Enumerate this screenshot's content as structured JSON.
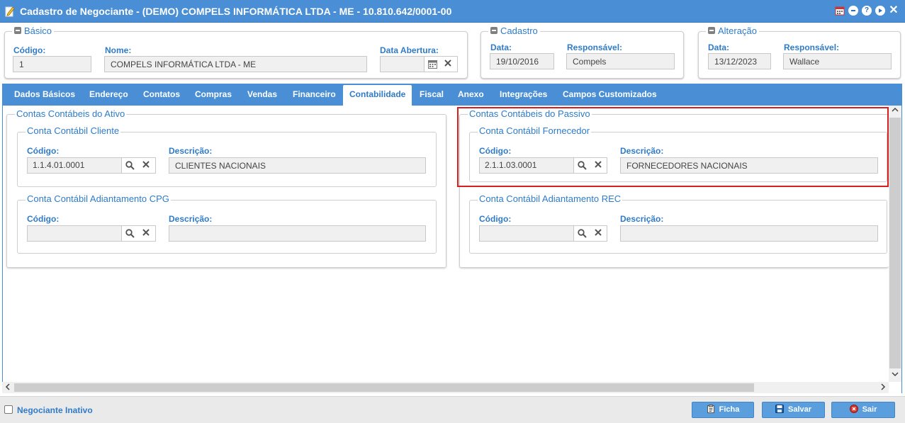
{
  "window": {
    "title": "Cadastro de Negociante - (DEMO) COMPELS INFORMÁTICA LTDA - ME - 10.810.642/0001-00",
    "controls": [
      "calendar-icon",
      "minimize-icon",
      "help-icon",
      "play-icon",
      "close-icon"
    ]
  },
  "basico": {
    "title": "Básico",
    "codigo_label": "Código:",
    "codigo_value": "1",
    "nome_label": "Nome:",
    "nome_value": "COMPELS INFORMÁTICA LTDA - ME",
    "data_abertura_label": "Data Abertura:",
    "data_abertura_value": ""
  },
  "cadastro": {
    "title": "Cadastro",
    "data_label": "Data:",
    "data_value": "19/10/2016",
    "responsavel_label": "Responsável:",
    "responsavel_value": "Compels"
  },
  "alteracao": {
    "title": "Alteração",
    "data_label": "Data:",
    "data_value": "13/12/2023",
    "responsavel_label": "Responsável:",
    "responsavel_value": "Wallace"
  },
  "tabs": [
    {
      "label": "Dados Básicos"
    },
    {
      "label": "Endereço"
    },
    {
      "label": "Contatos"
    },
    {
      "label": "Compras"
    },
    {
      "label": "Vendas"
    },
    {
      "label": "Financeiro"
    },
    {
      "label": "Contabilidade",
      "active": true
    },
    {
      "label": "Fiscal"
    },
    {
      "label": "Anexo"
    },
    {
      "label": "Integrações"
    },
    {
      "label": "Campos Customizados"
    }
  ],
  "ativo": {
    "title": "Contas Contábeis do Ativo",
    "cliente": {
      "title": "Conta Contábil Cliente",
      "codigo_label": "Código:",
      "codigo_value": "1.1.4.01.0001",
      "descricao_label": "Descrição:",
      "descricao_value": "CLIENTES NACIONAIS"
    },
    "adiantamento": {
      "title": "Conta Contábil Adiantamento CPG",
      "codigo_label": "Código:",
      "codigo_value": "",
      "descricao_label": "Descrição:",
      "descricao_value": ""
    }
  },
  "passivo": {
    "title": "Contas Contábeis do Passivo",
    "fornecedor": {
      "title": "Conta Contábil Fornecedor",
      "codigo_label": "Código:",
      "codigo_value": "2.1.1.03.0001",
      "descricao_label": "Descrição:",
      "descricao_value": "FORNECEDORES NACIONAIS"
    },
    "adiantamento": {
      "title": "Conta Contábil Adiantamento REC",
      "codigo_label": "Código:",
      "codigo_value": "",
      "descricao_label": "Descrição:",
      "descricao_value": ""
    }
  },
  "footer": {
    "inativo_label": "Negociante Inativo",
    "ficha_label": "Ficha",
    "salvar_label": "Salvar",
    "sair_label": "Sair"
  },
  "colors": {
    "accent": "#4a8fd5",
    "label": "#2f7bc8",
    "highlight": "#d81f1f"
  }
}
